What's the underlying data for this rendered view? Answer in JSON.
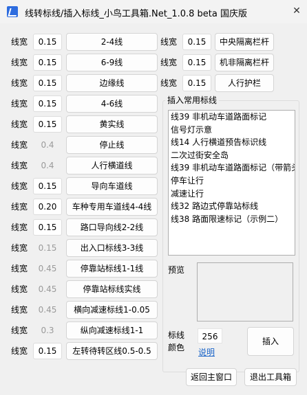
{
  "window": {
    "title": "线转标线/插入标线_小鸟工具箱.Net_1.0.8 beta 国庆版",
    "close_glyph": "✕"
  },
  "left_rows": [
    {
      "label": "线宽",
      "value": "0.15",
      "value_enabled": true,
      "button": "2-4线",
      "button_enabled": true
    },
    {
      "label": "线宽",
      "value": "0.15",
      "value_enabled": true,
      "button": "6-9线",
      "button_enabled": true
    },
    {
      "label": "线宽",
      "value": "0.15",
      "value_enabled": true,
      "button": "边缘线",
      "button_enabled": true
    },
    {
      "label": "线宽",
      "value": "0.15",
      "value_enabled": true,
      "button": "4-6线",
      "button_enabled": true
    },
    {
      "label": "线宽",
      "value": "0.15",
      "value_enabled": true,
      "button": "黄实线",
      "button_enabled": true
    },
    {
      "label": "线宽",
      "value": "0.4",
      "value_enabled": false,
      "button": "停止线",
      "button_enabled": true
    },
    {
      "label": "线宽",
      "value": "0.4",
      "value_enabled": false,
      "button": "人行横道线",
      "button_enabled": true
    },
    {
      "label": "线宽",
      "value": "0.15",
      "value_enabled": true,
      "button": "导向车道线",
      "button_enabled": true
    },
    {
      "label": "线宽",
      "value": "0.20",
      "value_enabled": true,
      "button": "车种专用车道线4-4线",
      "button_enabled": true
    },
    {
      "label": "线宽",
      "value": "0.15",
      "value_enabled": true,
      "button": "路口导向线2-2线",
      "button_enabled": true
    },
    {
      "label": "线宽",
      "value": "0.15",
      "value_enabled": false,
      "button": "出入口标线3-3线",
      "button_enabled": true
    },
    {
      "label": "线宽",
      "value": "0.45",
      "value_enabled": false,
      "button": "停靠站标线1-1线",
      "button_enabled": true
    },
    {
      "label": "线宽",
      "value": "0.45",
      "value_enabled": false,
      "button": "停靠站标线实线",
      "button_enabled": true
    },
    {
      "label": "线宽",
      "value": "0.45",
      "value_enabled": false,
      "button": "横向减速标线1-0.05",
      "button_enabled": true
    },
    {
      "label": "线宽",
      "value": "0.3",
      "value_enabled": false,
      "button": "纵向减速标线1-1",
      "button_enabled": true
    },
    {
      "label": "线宽",
      "value": "0.15",
      "value_enabled": true,
      "button": "左转待转区线0.5-0.5",
      "button_enabled": true
    }
  ],
  "right_rows": [
    {
      "label": "线宽",
      "value": "0.15",
      "button": "中央隔离栏杆"
    },
    {
      "label": "线宽",
      "value": "0.15",
      "button": "机非隔离栏杆"
    },
    {
      "label": "线宽",
      "value": "0.15",
      "button": "人行护栏"
    }
  ],
  "insert_group": {
    "title": "插入常用标线",
    "items": [
      "线39 非机动车道路面标记",
      "信号灯示意",
      "线14 人行横道预告标识线",
      "二次过街安全岛",
      "线39 非机动车道路面标记（带箭头）",
      "停车让行",
      "减速让行",
      "线32 路边式停靠站标线",
      "线38 路面限速标记（示例二）"
    ],
    "preview_label": "预览",
    "color_label_line1": "标线",
    "color_label_line2": "颜色",
    "color_value": "256",
    "color_link": "说明",
    "insert_button": "插入"
  },
  "footer": {
    "return_button": "返回主窗口",
    "exit_button": "退出工具箱"
  }
}
